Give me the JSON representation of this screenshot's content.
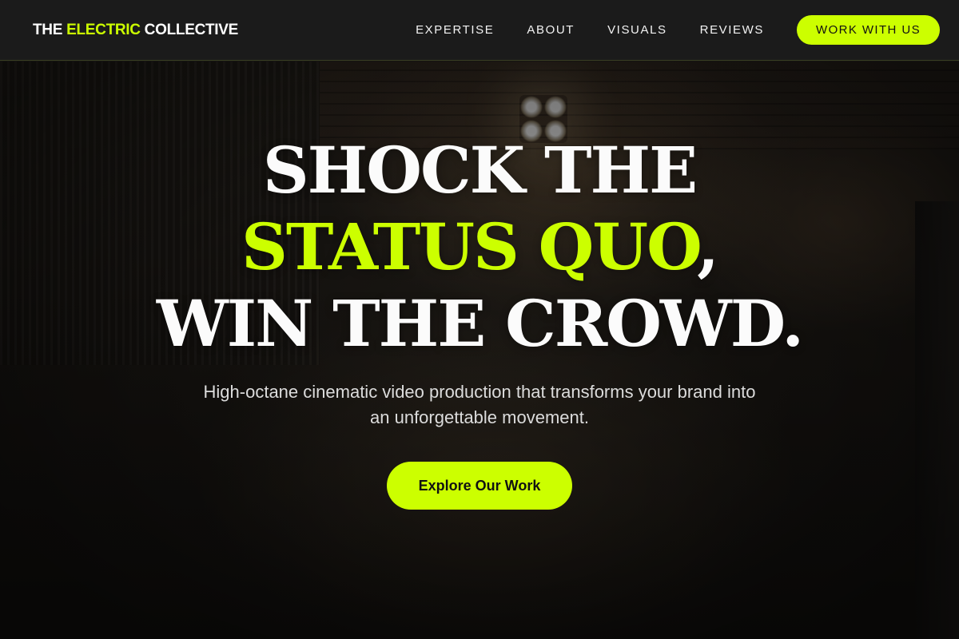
{
  "colors": {
    "accent": "#ccff00",
    "header_bg": "#1b1b1b",
    "headline_text": "#fbfbfb",
    "subtext": "#dcdcdc"
  },
  "brand": {
    "prefix": "THE ",
    "highlight": "ELECTRIC",
    "suffix": " COLLECTIVE"
  },
  "nav": {
    "items": [
      {
        "label": "EXPERTISE"
      },
      {
        "label": "ABOUT"
      },
      {
        "label": "VISUALS"
      },
      {
        "label": "REVIEWS"
      }
    ],
    "cta_label": "WORK WITH US"
  },
  "hero": {
    "headline_line1": "SHOCK THE",
    "headline_line2_accent": "STATUS QUO",
    "headline_line2_suffix": ",",
    "headline_line3": "WIN THE CROWD.",
    "subtext": "High-octane cinematic video production that transforms your brand into an unforgettable movement.",
    "cta_label": "Explore Our Work"
  }
}
